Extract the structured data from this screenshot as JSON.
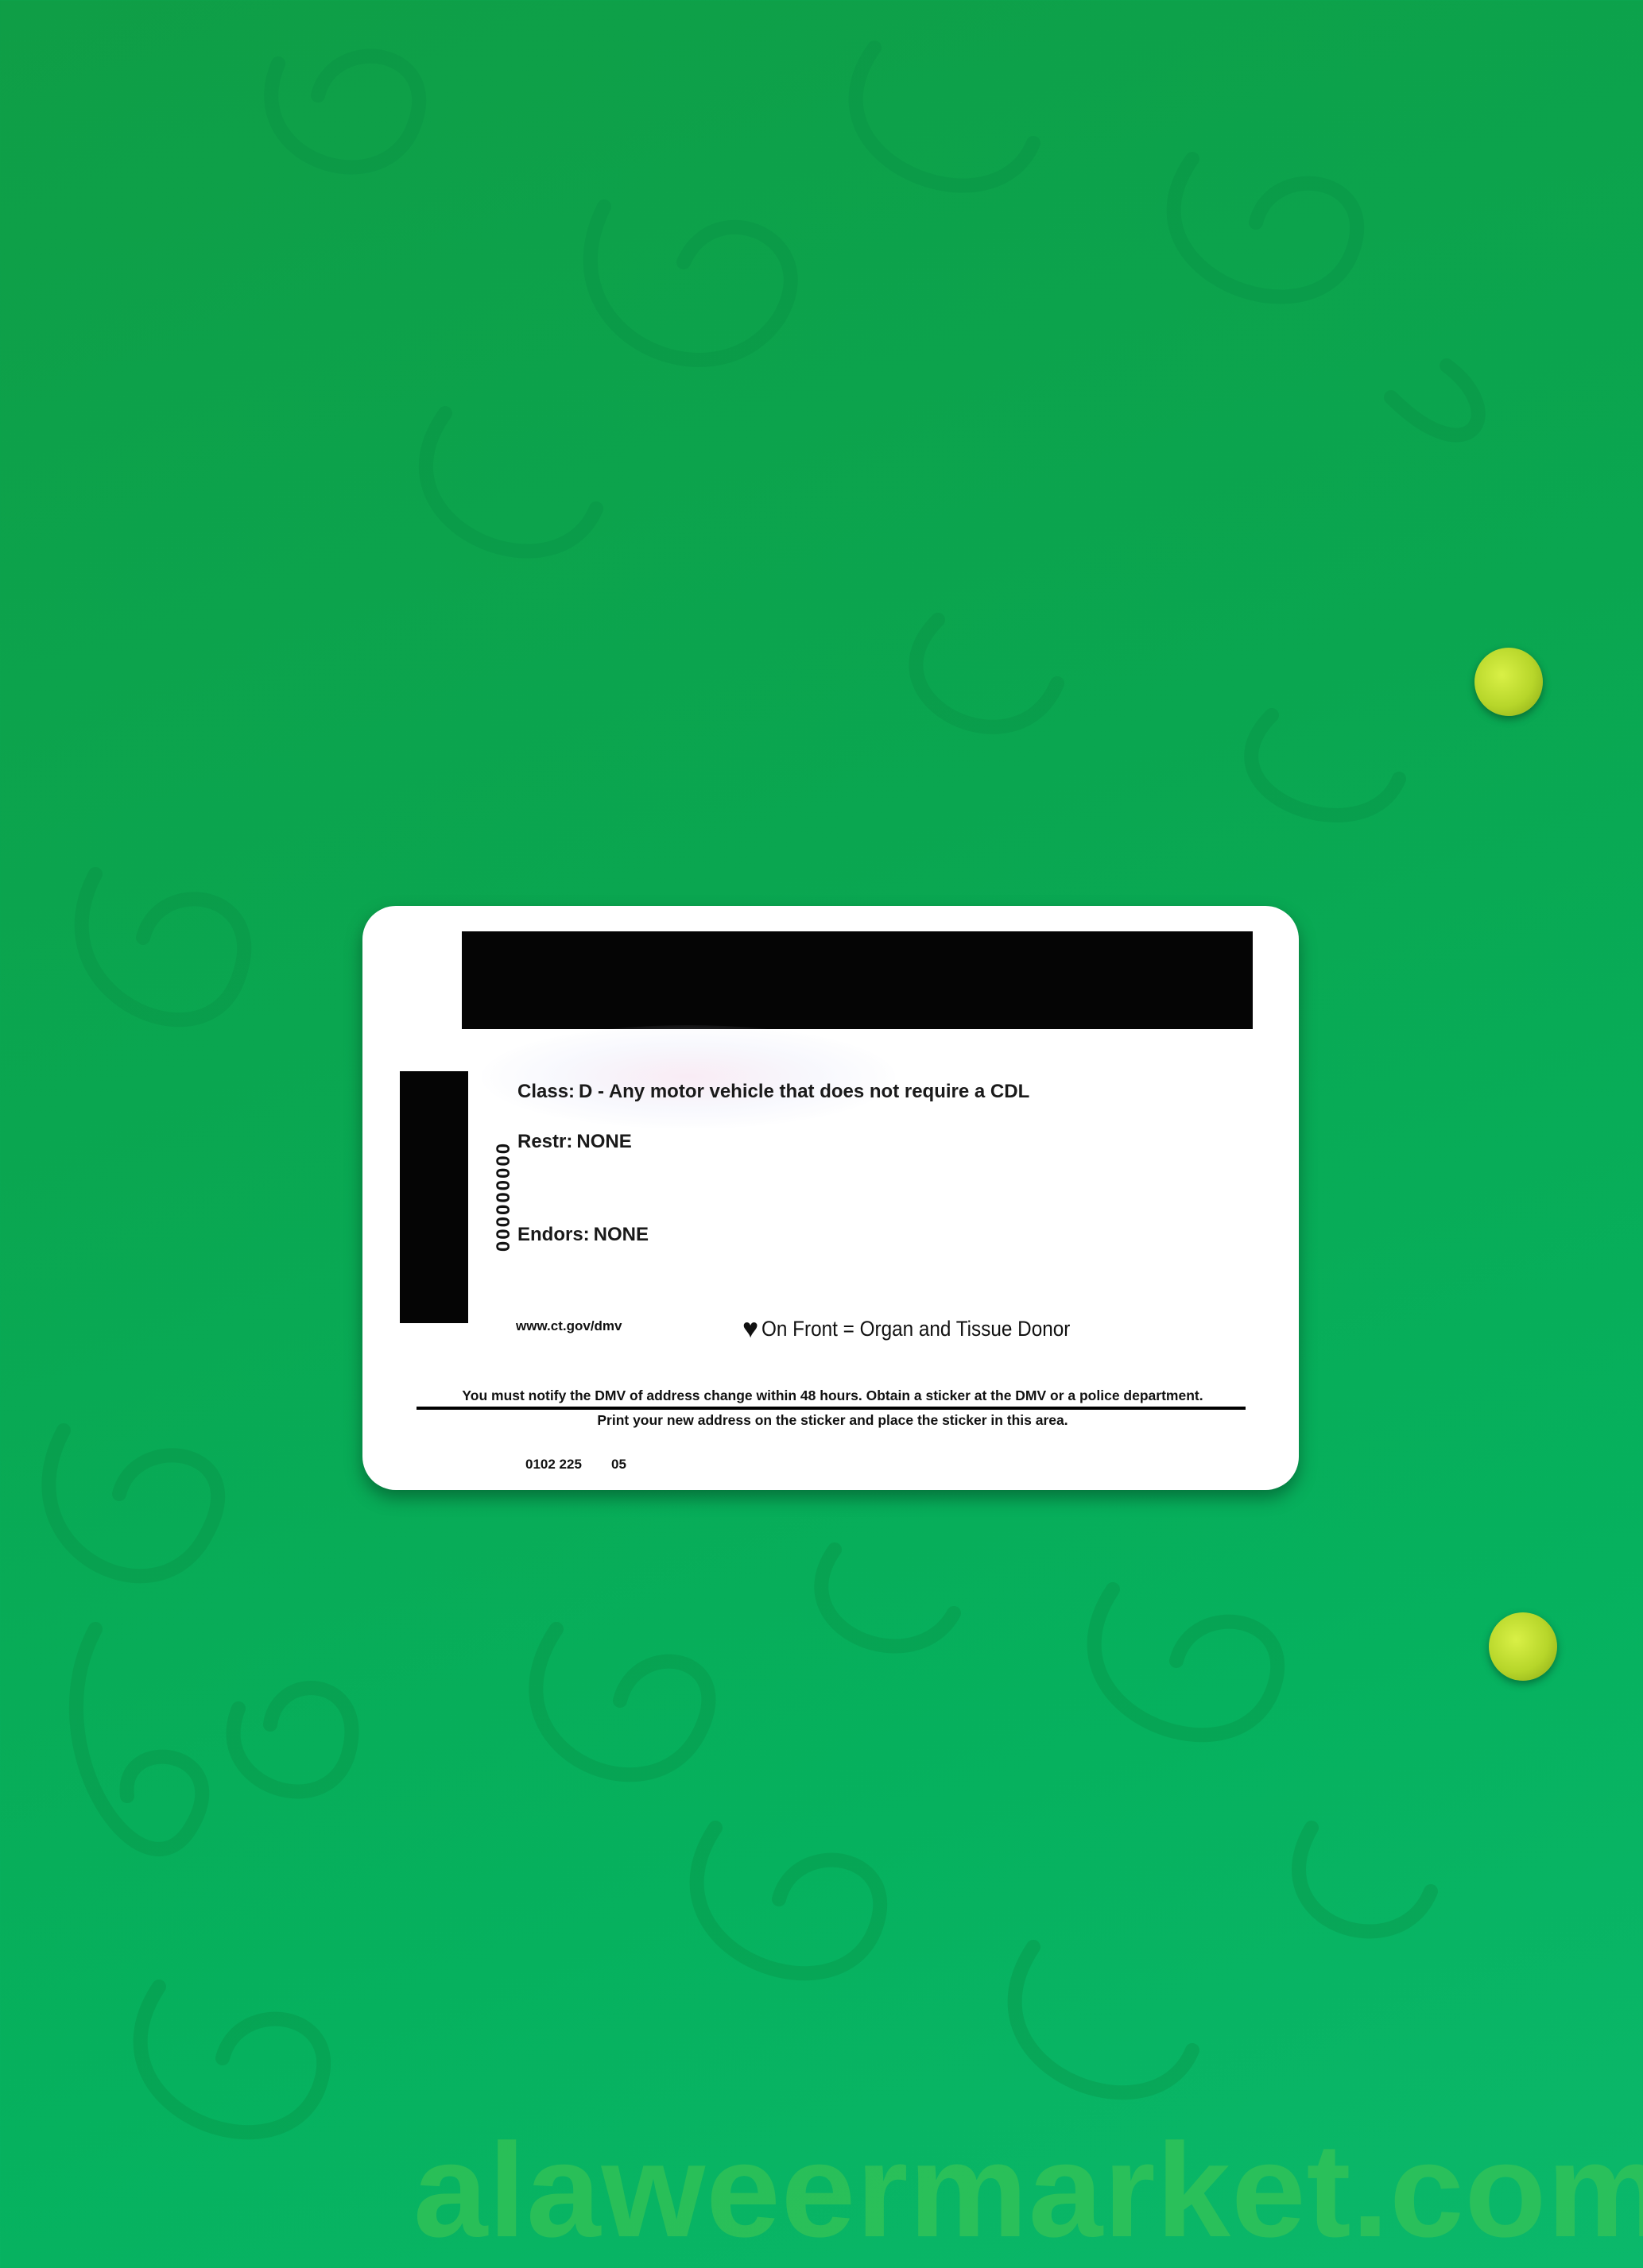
{
  "card": {
    "class_label": "Class:",
    "class_value": "D - Any motor vehicle that does not require a CDL",
    "restr_label": "Restr:",
    "restr_value": "NONE",
    "endors_label": "Endors:",
    "endors_value": "NONE",
    "vertical_number": "000000000",
    "website": "www.ct.gov/dmv",
    "donor_icon": "heart-icon",
    "donor_text": "On Front = Organ and Tissue Donor",
    "notice_line1": "You must notify the DMV of address change within 48 hours. Obtain a sticker at the DMV or a police department.",
    "notice_line2": "Print your new address on the sticker and place the sticker in this area.",
    "code_1": "0102 225",
    "code_2": "05"
  },
  "watermark": "alaweermarket.com",
  "colors": {
    "background": "#0aa650",
    "card": "#ffffff",
    "stripe": "#050505",
    "dots": "#c6e23a"
  }
}
